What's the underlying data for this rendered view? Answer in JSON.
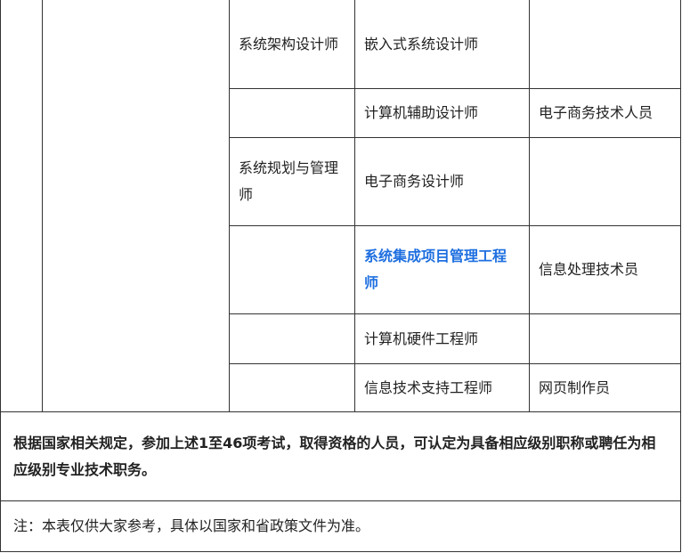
{
  "table": {
    "rows": [
      {
        "c3": "系统架构设计师",
        "c4": "嵌入式系统设计师",
        "c5": ""
      },
      {
        "c3": "",
        "c4": "计算机辅助设计师",
        "c5": "电子商务技术人员"
      },
      {
        "c3": "系统规划与管理师",
        "c4": "电子商务设计师",
        "c5": ""
      },
      {
        "c3": "",
        "c4": "系统集成项目管理工程师",
        "c5": "信息处理技术员"
      },
      {
        "c3": "",
        "c4": "计算机硬件工程师",
        "c5": ""
      },
      {
        "c3": "",
        "c4": "信息技术支持工程师",
        "c5": "网页制作员"
      }
    ],
    "highlight_color": "#1e6fe0"
  },
  "notes": {
    "regulation": "根据国家相关规定，参加上述1至46项考试，取得资格的人员，可认定为具备相应级别职称或聘任为相应级别专业技术职务。",
    "disclaimer": "注：本表仅供大家参考，具体以国家和省政策文件为准。"
  }
}
